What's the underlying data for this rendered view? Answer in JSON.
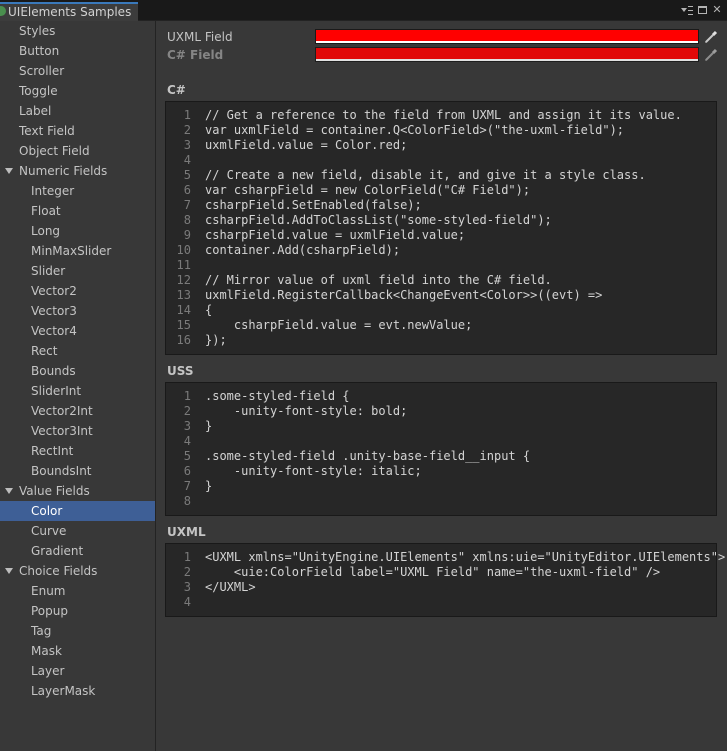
{
  "window": {
    "tab_title": "UIElements Samples",
    "controls": [
      "menu-icon",
      "maximize-icon",
      "close-icon"
    ]
  },
  "sidebar": {
    "items": [
      {
        "label": "Styles",
        "level": 0
      },
      {
        "label": "Button",
        "level": 0
      },
      {
        "label": "Scroller",
        "level": 0
      },
      {
        "label": "Toggle",
        "level": 0
      },
      {
        "label": "Label",
        "level": 0
      },
      {
        "label": "Text Field",
        "level": 0
      },
      {
        "label": "Object Field",
        "level": 0
      },
      {
        "label": "Numeric Fields",
        "level": 0,
        "expanded": true
      },
      {
        "label": "Integer",
        "level": 1
      },
      {
        "label": "Float",
        "level": 1
      },
      {
        "label": "Long",
        "level": 1
      },
      {
        "label": "MinMaxSlider",
        "level": 1
      },
      {
        "label": "Slider",
        "level": 1
      },
      {
        "label": "Vector2",
        "level": 1
      },
      {
        "label": "Vector3",
        "level": 1
      },
      {
        "label": "Vector4",
        "level": 1
      },
      {
        "label": "Rect",
        "level": 1
      },
      {
        "label": "Bounds",
        "level": 1
      },
      {
        "label": "SliderInt",
        "level": 1
      },
      {
        "label": "Vector2Int",
        "level": 1
      },
      {
        "label": "Vector3Int",
        "level": 1
      },
      {
        "label": "RectInt",
        "level": 1
      },
      {
        "label": "BoundsInt",
        "level": 1
      },
      {
        "label": "Value Fields",
        "level": 0,
        "expanded": true
      },
      {
        "label": "Color",
        "level": 1,
        "selected": true
      },
      {
        "label": "Curve",
        "level": 1
      },
      {
        "label": "Gradient",
        "level": 1
      },
      {
        "label": "Choice Fields",
        "level": 0,
        "expanded": true
      },
      {
        "label": "Enum",
        "level": 1
      },
      {
        "label": "Popup",
        "level": 1
      },
      {
        "label": "Tag",
        "level": 1
      },
      {
        "label": "Mask",
        "level": 1
      },
      {
        "label": "Layer",
        "level": 1
      },
      {
        "label": "LayerMask",
        "level": 1
      }
    ]
  },
  "fields": {
    "uxml": {
      "label": "UXML Field",
      "color": "#ff0000"
    },
    "csharp": {
      "label": "C# Field",
      "color": "#ff0000",
      "disabled": true,
      "bold": true
    }
  },
  "sections": {
    "csharp": {
      "title": "C#",
      "lines": [
        "// Get a reference to the field from UXML and assign it its value.",
        "var uxmlField = container.Q<ColorField>(\"the-uxml-field\");",
        "uxmlField.value = Color.red;",
        "",
        "// Create a new field, disable it, and give it a style class.",
        "var csharpField = new ColorField(\"C# Field\");",
        "csharpField.SetEnabled(false);",
        "csharpField.AddToClassList(\"some-styled-field\");",
        "csharpField.value = uxmlField.value;",
        "container.Add(csharpField);",
        "",
        "// Mirror value of uxml field into the C# field.",
        "uxmlField.RegisterCallback<ChangeEvent<Color>>((evt) =>",
        "{",
        "    csharpField.value = evt.newValue;",
        "});"
      ]
    },
    "uss": {
      "title": "USS",
      "lines": [
        ".some-styled-field {",
        "    -unity-font-style: bold;",
        "}",
        "",
        ".some-styled-field .unity-base-field__input {",
        "    -unity-font-style: italic;",
        "}",
        ""
      ]
    },
    "uxml": {
      "title": "UXML",
      "lines": [
        "<UXML xmlns=\"UnityEngine.UIElements\" xmlns:uie=\"UnityEditor.UIElements\">",
        "    <uie:ColorField label=\"UXML Field\" name=\"the-uxml-field\" />",
        "</UXML>",
        ""
      ]
    }
  }
}
